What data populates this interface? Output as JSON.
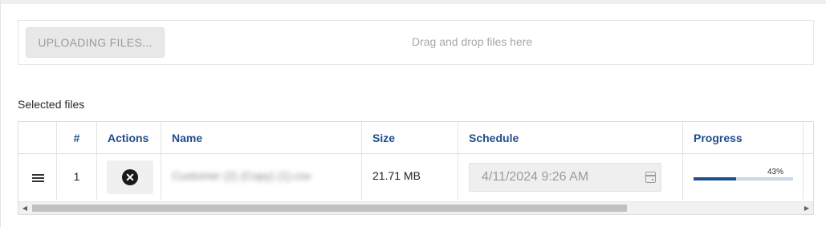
{
  "uploader": {
    "button_label": "UPLOADING FILES...",
    "drop_hint": "Drag and drop files here"
  },
  "selected_files": {
    "title": "Selected files",
    "columns": [
      "#",
      "Actions",
      "Name",
      "Size",
      "Schedule",
      "Progress"
    ],
    "rows": [
      {
        "index": "1",
        "name": "Customer (2) (Copy) (1).csv",
        "size": "21.71 MB",
        "schedule": "4/11/2024 9:26 AM",
        "progress_label": "43%",
        "progress": 0.43
      }
    ]
  },
  "icons": {
    "drag": "drag-handle-icon",
    "remove": "remove-circle-icon",
    "calendar": "calendar-icon"
  },
  "colors": {
    "header_text": "#1f4e8c",
    "progress_fill": "#1f4e8c",
    "progress_track": "#c8d8e8"
  }
}
